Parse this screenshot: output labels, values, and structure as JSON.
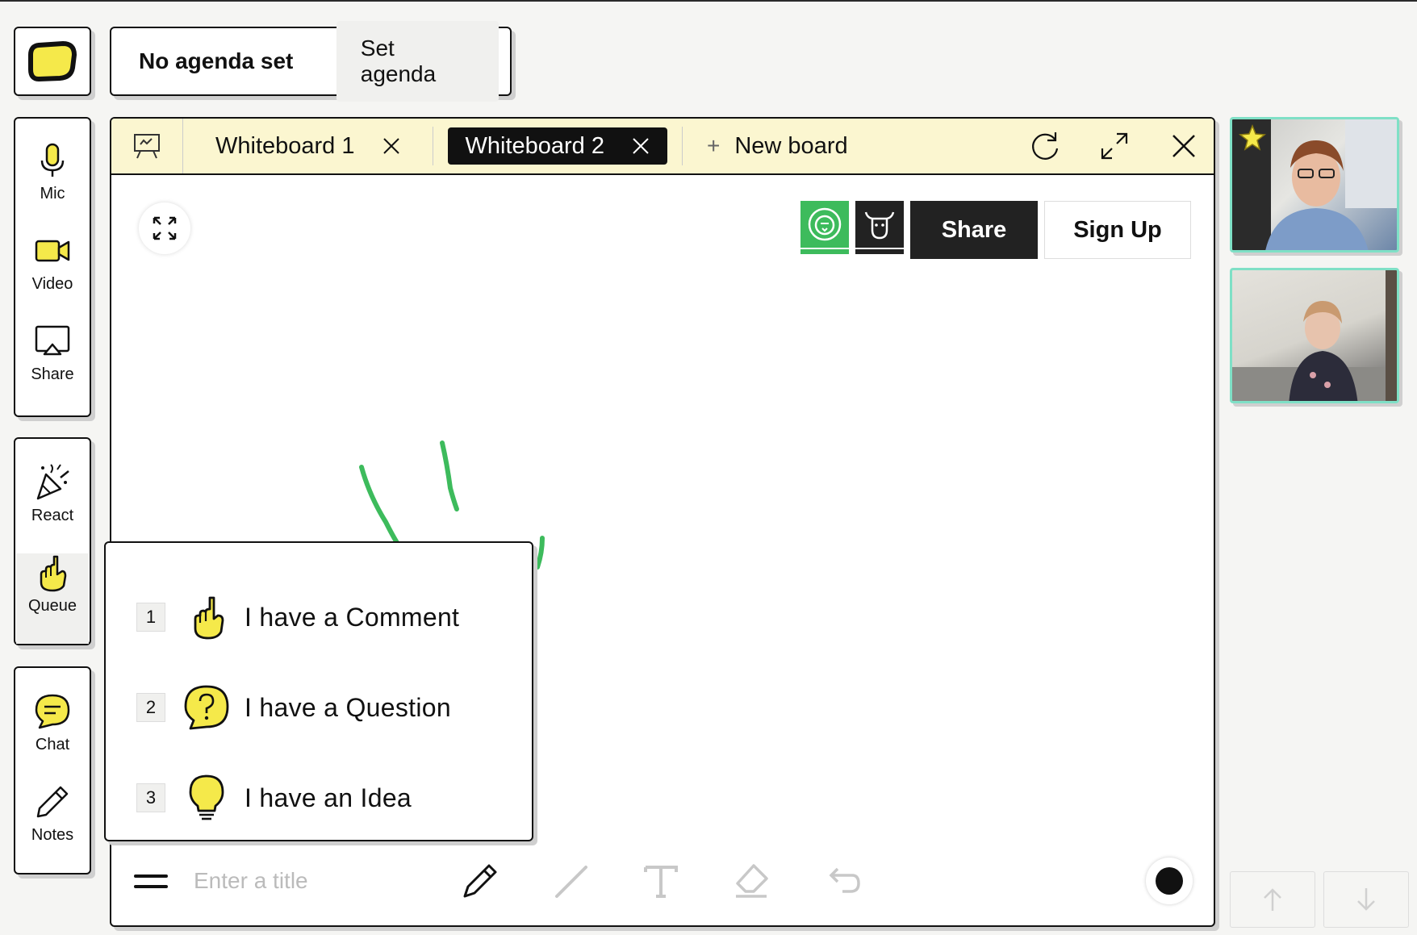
{
  "agenda": {
    "status": "No agenda set",
    "button": "Set agenda"
  },
  "sidebar": {
    "media": [
      {
        "label": "Mic",
        "icon": "mic-icon"
      },
      {
        "label": "Video",
        "icon": "video-camera-icon"
      },
      {
        "label": "Share",
        "icon": "screen-share-icon"
      }
    ],
    "engage": [
      {
        "label": "React",
        "icon": "party-popper-icon"
      },
      {
        "label": "Queue",
        "icon": "raised-hand-icon"
      }
    ],
    "tools": [
      {
        "label": "Chat",
        "icon": "chat-bubble-icon"
      },
      {
        "label": "Notes",
        "icon": "pencil-icon"
      }
    ]
  },
  "whiteboard": {
    "tabs": [
      {
        "label": "Whiteboard 1",
        "active": false
      },
      {
        "label": "Whiteboard 2",
        "active": true
      }
    ],
    "new_board": "New board",
    "share": "Share",
    "sign_up": "Sign Up",
    "title_placeholder": "Enter a title",
    "brush_color": "#111111",
    "stroke_color": "#3dbb5c"
  },
  "queue": {
    "items": [
      {
        "num": "1",
        "label": "I have a Comment",
        "icon": "pointing-finger-icon"
      },
      {
        "num": "2",
        "label": "I have a Question",
        "icon": "question-bubble-icon"
      },
      {
        "num": "3",
        "label": "I have an Idea",
        "icon": "lightbulb-icon"
      }
    ]
  },
  "colors": {
    "accent_yellow": "#f5e94a",
    "video_border": "#7fe0c6",
    "tab_bar": "#fbf6d0",
    "avatar_green": "#3dbb5c"
  }
}
